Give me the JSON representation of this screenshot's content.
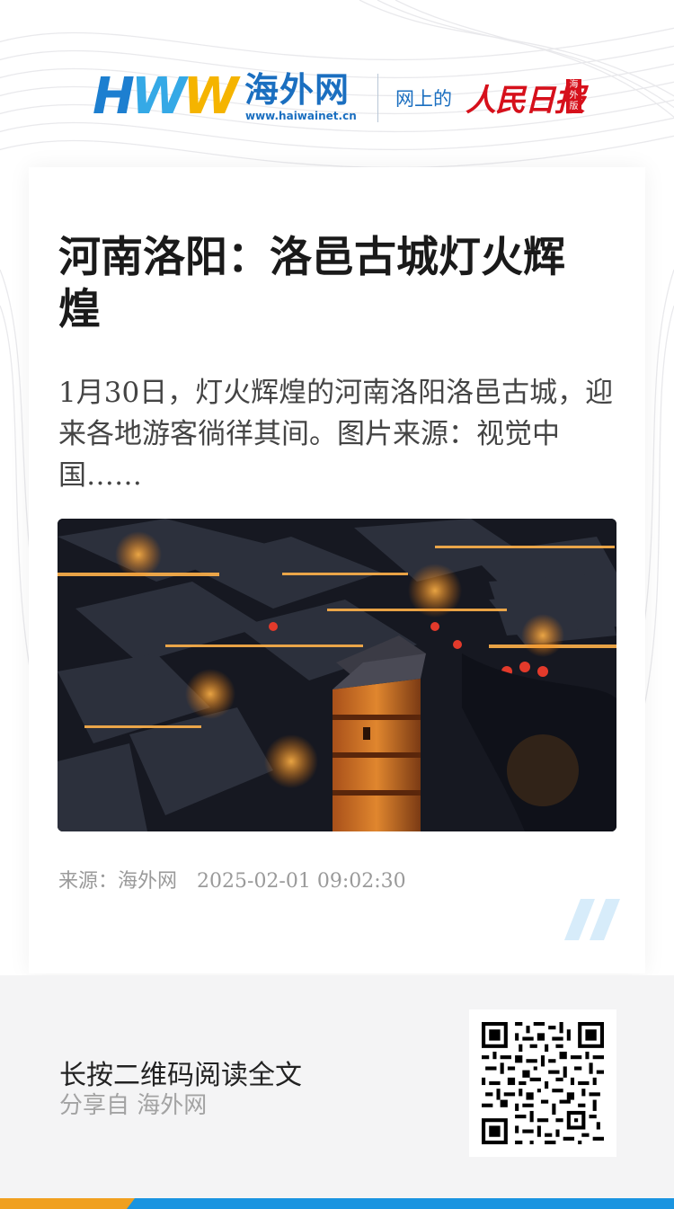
{
  "brand": {
    "logo_letters": [
      "H",
      "W",
      "W"
    ],
    "logo_name": "海外网",
    "logo_url": "www.haiwainet.cn",
    "partner_prefix": "网上的",
    "partner_name": "人民日报",
    "partner_seal": "海外版",
    "colors": {
      "blue": "#1b6fc0",
      "yellow": "#f5b400",
      "red": "#d6101b"
    }
  },
  "article": {
    "title": "河南洛阳：洛邑古城灯火辉煌",
    "summary": "1月30日，灯火辉煌的河南洛阳洛邑古城，迎来各地游客徜徉其间。图片来源：视觉中国……",
    "source": "来源：海外网",
    "datetime": "2025-02-01 09:02:30",
    "photo": "night aerial view of illuminated ancient town with pagoda"
  },
  "footer": {
    "prompt": "长按二维码阅读全文",
    "share": "分享自 海外网",
    "qr_icon": "qr-code-icon"
  }
}
